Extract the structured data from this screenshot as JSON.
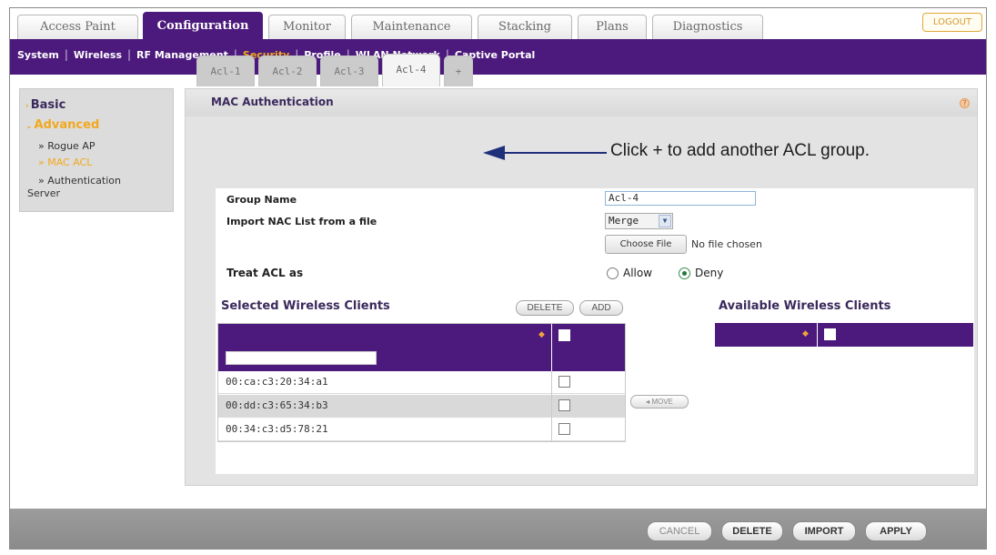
{
  "top_tabs": [
    "Access Paint",
    "Configuration",
    "Monitor",
    "Maintenance",
    "Stacking",
    "Plans",
    "Diagnostics"
  ],
  "active_top_tab": "Configuration",
  "logout_label": "LOGOUT",
  "subnav": [
    "System",
    "Wireless",
    "RF Management",
    "Security",
    "Profile",
    "WLAN Network",
    "Captive Portal"
  ],
  "active_subnav": "Security",
  "sidebar": {
    "basic": "Basic",
    "advanced": "Advanced",
    "rogue_ap": "» Rogue AP",
    "mac_acl": "» MAC ACL",
    "auth_server_1": "» Authentication",
    "auth_server_2": "Server"
  },
  "panel": {
    "title": "MAC Authentication",
    "help": "?"
  },
  "acl_tabs": [
    "Acl-1",
    "Acl-2",
    "Acl-3",
    "Acl-4",
    "+"
  ],
  "active_acl_tab": "Acl-4",
  "annotation": "Click + to add another ACL group.",
  "form": {
    "group_name_label": "Group Name",
    "group_name_value": "Acl-4",
    "import_label": "Import NAC List from a file",
    "import_mode": "Merge",
    "choose_file": "Choose File",
    "no_file": "No file chosen",
    "treat_label": "Treat ACL as",
    "allow": "Allow",
    "deny": "Deny",
    "treat_value": "Deny"
  },
  "selected": {
    "title": "Selected Wireless Clients",
    "delete_btn": "DELETE",
    "add_btn": "ADD",
    "rows": [
      "00:ca:c3:20:34:a1",
      "00:dd:c3:65:34:b3",
      "00:34:c3:d5:78:21"
    ]
  },
  "move_btn": "◂ MOVE",
  "available": {
    "title": "Available Wireless Clients"
  },
  "footer": {
    "cancel": "CANCEL",
    "delete": "DELETE",
    "import": "IMPORT",
    "apply": "APPLY"
  },
  "colors": {
    "brand_purple": "#4c1a7c",
    "accent_orange": "#f2a81d"
  }
}
